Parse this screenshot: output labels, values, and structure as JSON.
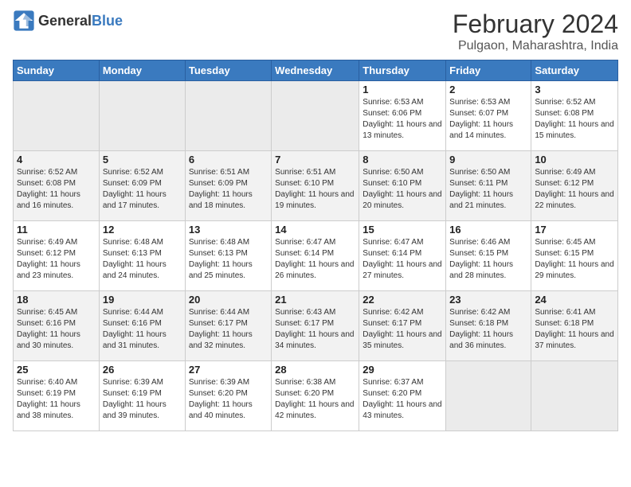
{
  "header": {
    "logo_general": "General",
    "logo_blue": "Blue",
    "month_year": "February 2024",
    "location": "Pulgaon, Maharashtra, India"
  },
  "days": [
    "Sunday",
    "Monday",
    "Tuesday",
    "Wednesday",
    "Thursday",
    "Friday",
    "Saturday"
  ],
  "weeks": [
    [
      {
        "date": "",
        "sunrise": "",
        "sunset": "",
        "daylight": ""
      },
      {
        "date": "",
        "sunrise": "",
        "sunset": "",
        "daylight": ""
      },
      {
        "date": "",
        "sunrise": "",
        "sunset": "",
        "daylight": ""
      },
      {
        "date": "",
        "sunrise": "",
        "sunset": "",
        "daylight": ""
      },
      {
        "date": "1",
        "sunrise": "6:53 AM",
        "sunset": "6:06 PM",
        "daylight": "11 hours and 13 minutes."
      },
      {
        "date": "2",
        "sunrise": "6:53 AM",
        "sunset": "6:07 PM",
        "daylight": "11 hours and 14 minutes."
      },
      {
        "date": "3",
        "sunrise": "6:52 AM",
        "sunset": "6:08 PM",
        "daylight": "11 hours and 15 minutes."
      }
    ],
    [
      {
        "date": "4",
        "sunrise": "6:52 AM",
        "sunset": "6:08 PM",
        "daylight": "11 hours and 16 minutes."
      },
      {
        "date": "5",
        "sunrise": "6:52 AM",
        "sunset": "6:09 PM",
        "daylight": "11 hours and 17 minutes."
      },
      {
        "date": "6",
        "sunrise": "6:51 AM",
        "sunset": "6:09 PM",
        "daylight": "11 hours and 18 minutes."
      },
      {
        "date": "7",
        "sunrise": "6:51 AM",
        "sunset": "6:10 PM",
        "daylight": "11 hours and 19 minutes."
      },
      {
        "date": "8",
        "sunrise": "6:50 AM",
        "sunset": "6:10 PM",
        "daylight": "11 hours and 20 minutes."
      },
      {
        "date": "9",
        "sunrise": "6:50 AM",
        "sunset": "6:11 PM",
        "daylight": "11 hours and 21 minutes."
      },
      {
        "date": "10",
        "sunrise": "6:49 AM",
        "sunset": "6:12 PM",
        "daylight": "11 hours and 22 minutes."
      }
    ],
    [
      {
        "date": "11",
        "sunrise": "6:49 AM",
        "sunset": "6:12 PM",
        "daylight": "11 hours and 23 minutes."
      },
      {
        "date": "12",
        "sunrise": "6:48 AM",
        "sunset": "6:13 PM",
        "daylight": "11 hours and 24 minutes."
      },
      {
        "date": "13",
        "sunrise": "6:48 AM",
        "sunset": "6:13 PM",
        "daylight": "11 hours and 25 minutes."
      },
      {
        "date": "14",
        "sunrise": "6:47 AM",
        "sunset": "6:14 PM",
        "daylight": "11 hours and 26 minutes."
      },
      {
        "date": "15",
        "sunrise": "6:47 AM",
        "sunset": "6:14 PM",
        "daylight": "11 hours and 27 minutes."
      },
      {
        "date": "16",
        "sunrise": "6:46 AM",
        "sunset": "6:15 PM",
        "daylight": "11 hours and 28 minutes."
      },
      {
        "date": "17",
        "sunrise": "6:45 AM",
        "sunset": "6:15 PM",
        "daylight": "11 hours and 29 minutes."
      }
    ],
    [
      {
        "date": "18",
        "sunrise": "6:45 AM",
        "sunset": "6:16 PM",
        "daylight": "11 hours and 30 minutes."
      },
      {
        "date": "19",
        "sunrise": "6:44 AM",
        "sunset": "6:16 PM",
        "daylight": "11 hours and 31 minutes."
      },
      {
        "date": "20",
        "sunrise": "6:44 AM",
        "sunset": "6:17 PM",
        "daylight": "11 hours and 32 minutes."
      },
      {
        "date": "21",
        "sunrise": "6:43 AM",
        "sunset": "6:17 PM",
        "daylight": "11 hours and 34 minutes."
      },
      {
        "date": "22",
        "sunrise": "6:42 AM",
        "sunset": "6:17 PM",
        "daylight": "11 hours and 35 minutes."
      },
      {
        "date": "23",
        "sunrise": "6:42 AM",
        "sunset": "6:18 PM",
        "daylight": "11 hours and 36 minutes."
      },
      {
        "date": "24",
        "sunrise": "6:41 AM",
        "sunset": "6:18 PM",
        "daylight": "11 hours and 37 minutes."
      }
    ],
    [
      {
        "date": "25",
        "sunrise": "6:40 AM",
        "sunset": "6:19 PM",
        "daylight": "11 hours and 38 minutes."
      },
      {
        "date": "26",
        "sunrise": "6:39 AM",
        "sunset": "6:19 PM",
        "daylight": "11 hours and 39 minutes."
      },
      {
        "date": "27",
        "sunrise": "6:39 AM",
        "sunset": "6:20 PM",
        "daylight": "11 hours and 40 minutes."
      },
      {
        "date": "28",
        "sunrise": "6:38 AM",
        "sunset": "6:20 PM",
        "daylight": "11 hours and 42 minutes."
      },
      {
        "date": "29",
        "sunrise": "6:37 AM",
        "sunset": "6:20 PM",
        "daylight": "11 hours and 43 minutes."
      },
      {
        "date": "",
        "sunrise": "",
        "sunset": "",
        "daylight": ""
      },
      {
        "date": "",
        "sunrise": "",
        "sunset": "",
        "daylight": ""
      }
    ]
  ]
}
